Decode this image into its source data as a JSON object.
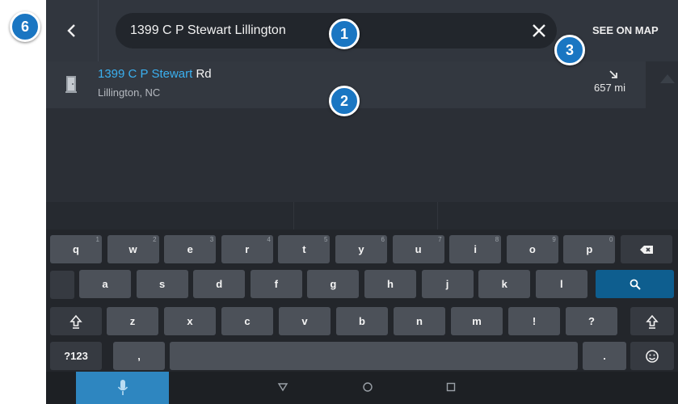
{
  "search": {
    "query": "1399 C P Stewart Lillington"
  },
  "see_on_map_label": "SEE ON MAP",
  "result": {
    "name_match": "1399 C P Stewart",
    "name_rest": " Rd",
    "city": "Lillington, NC",
    "distance": "657 mi"
  },
  "keyboard": {
    "row1": [
      {
        "k": "q",
        "n": "1"
      },
      {
        "k": "w",
        "n": "2"
      },
      {
        "k": "e",
        "n": "3"
      },
      {
        "k": "r",
        "n": "4"
      },
      {
        "k": "t",
        "n": "5"
      },
      {
        "k": "y",
        "n": "6"
      },
      {
        "k": "u",
        "n": "7"
      },
      {
        "k": "i",
        "n": "8"
      },
      {
        "k": "o",
        "n": "9"
      },
      {
        "k": "p",
        "n": "0"
      }
    ],
    "row2": [
      "a",
      "s",
      "d",
      "f",
      "g",
      "h",
      "j",
      "k",
      "l"
    ],
    "row3": [
      "z",
      "x",
      "c",
      "v",
      "b",
      "n",
      "m",
      "!",
      "?"
    ],
    "symbols_label": "?123",
    "comma": ",",
    "period": "."
  },
  "callouts": [
    "1",
    "2",
    "3",
    "6"
  ],
  "colors": {
    "accent": "#1a76c2",
    "match_text": "#3bb0f0",
    "search_key": "#0e5e8f",
    "mic_bar": "#2e86c0"
  }
}
